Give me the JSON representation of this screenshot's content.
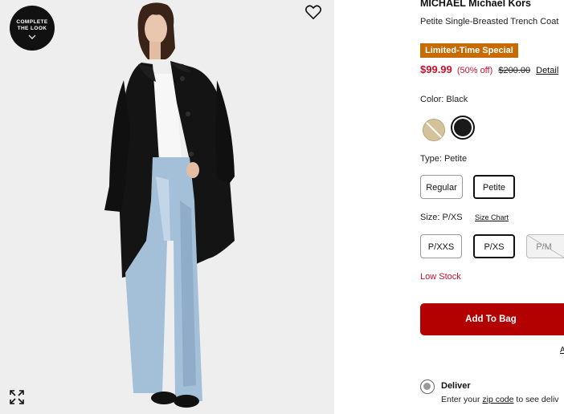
{
  "gallery": {
    "badge_line1": "COMPLETE",
    "badge_line2": "THE LOOK",
    "icons": [
      "heart-icon",
      "expand-icon",
      "chevron-down-icon"
    ]
  },
  "product": {
    "brand": "MICHAEL Michael Kors",
    "title": "Petite Single-Breasted Trench Coat",
    "promo": "Limited-Time Special",
    "price_now": "$99.99",
    "price_off": "(50% off)",
    "price_was": "$200.00",
    "details_link": "Detail"
  },
  "color": {
    "label": "Color: Black",
    "swatches": [
      "tan",
      "black"
    ],
    "selected": "black"
  },
  "type": {
    "label": "Type: Petite",
    "options": [
      "Regular",
      "Petite"
    ],
    "selected": "Petite"
  },
  "size": {
    "label": "Size: P/XS",
    "chart_link": "Size Chart",
    "options": [
      "P/XXS",
      "P/XS",
      "P/M"
    ],
    "selected": "P/XS",
    "unavailable": [
      "P/M"
    ]
  },
  "stock": "Low Stock",
  "cart": {
    "add_label": "Add To Bag",
    "link_fragment": "A"
  },
  "delivery": {
    "label": "Deliver",
    "sub_prefix": "Enter your",
    "sub_link": "zip code",
    "sub_suffix": "to see deliv"
  },
  "colors": {
    "price_red": "#c8102e",
    "promo_orange": "#c76b00",
    "cta_red": "#b30000"
  }
}
